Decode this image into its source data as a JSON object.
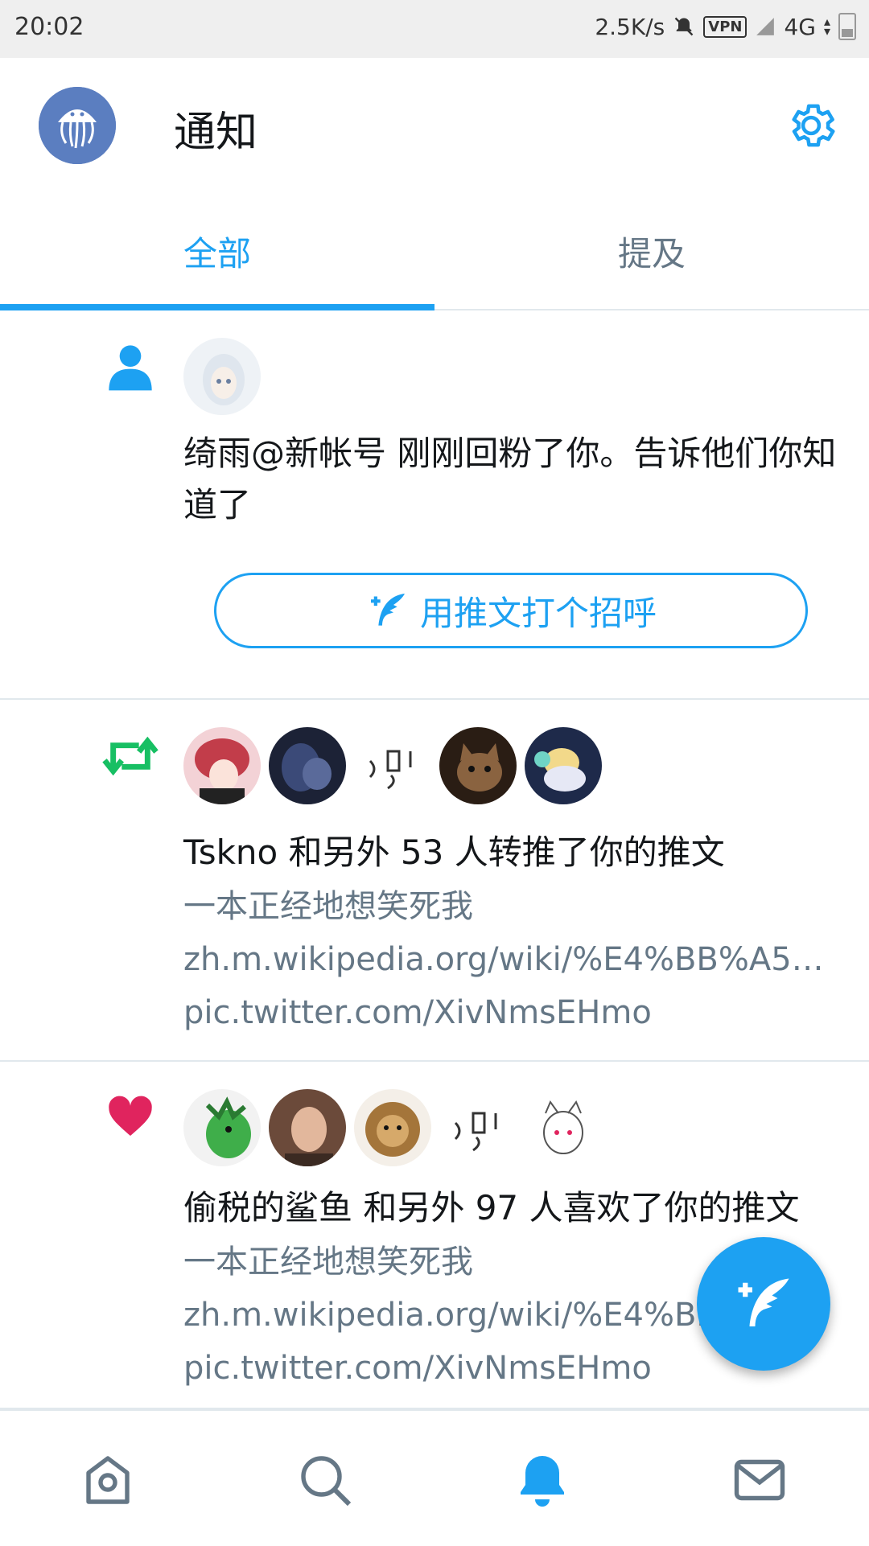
{
  "status_bar": {
    "time": "20:02",
    "net_speed": "2.5K/s",
    "vpn": "VPN",
    "network": "4G"
  },
  "header": {
    "title": "通知",
    "avatar_icon": "jellyfish-avatar",
    "settings_icon": "gear-icon"
  },
  "tabs": [
    {
      "label": "全部",
      "active": true
    },
    {
      "label": "提及",
      "active": false
    }
  ],
  "notifications": [
    {
      "type": "follow",
      "icon": "person-icon",
      "message": "绮雨@新帐号 刚刚回粉了你。告诉他们你知道了",
      "button_label": "用推文打个招呼"
    },
    {
      "type": "retweet",
      "icon": "retweet-icon",
      "message": "Tskno 和另外 53 人转推了你的推文",
      "tweet_text": "一本正经地想笑死我",
      "link1": "zh.m.wikipedia.org/wiki/%E4%BB%A5…",
      "link2": "pic.twitter.com/XivNmsEHmo"
    },
    {
      "type": "like",
      "icon": "heart-icon",
      "message": "偷税的鲨鱼 和另外 97 人喜欢了你的推文",
      "tweet_text": "一本正经地想笑死我",
      "link1": "zh.m.wikipedia.org/wiki/%E4%BB",
      "link2": "pic.twitter.com/XivNmsEHmo"
    }
  ],
  "colors": {
    "accent": "#1da1f2",
    "retweet": "#17bf63",
    "like": "#e0245e",
    "muted": "#657786"
  },
  "bottom_nav": [
    "home-icon",
    "search-icon",
    "bell-icon",
    "mail-icon"
  ]
}
